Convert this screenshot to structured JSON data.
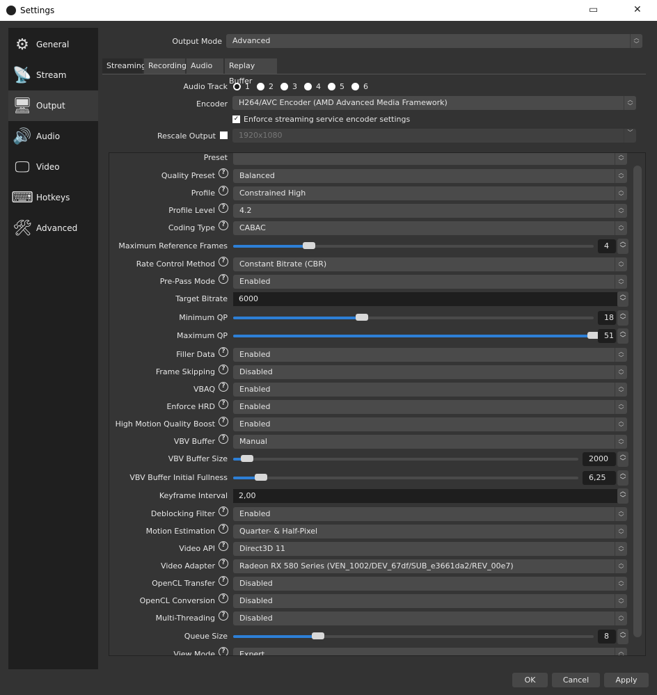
{
  "window": {
    "title": "Settings"
  },
  "sidebar": {
    "items": [
      {
        "label": "General",
        "icon": "gear-icon",
        "glyph": "⚙"
      },
      {
        "label": "Stream",
        "icon": "antenna-icon",
        "glyph": "📡"
      },
      {
        "label": "Output",
        "icon": "monitor-arrow-icon",
        "glyph": "🖥",
        "selected": true
      },
      {
        "label": "Audio",
        "icon": "speaker-icon",
        "glyph": "🔊"
      },
      {
        "label": "Video",
        "icon": "monitor-icon",
        "glyph": "🖵"
      },
      {
        "label": "Hotkeys",
        "icon": "keyboard-icon",
        "glyph": "⌨"
      },
      {
        "label": "Advanced",
        "icon": "tools-icon",
        "glyph": "🛠"
      }
    ]
  },
  "output_mode": {
    "label": "Output Mode",
    "value": "Advanced"
  },
  "tabs": [
    "Streaming",
    "Recording",
    "Audio",
    "Replay Buffer"
  ],
  "audio_track": {
    "label": "Audio Track",
    "tracks": [
      "1",
      "2",
      "3",
      "4",
      "5",
      "6"
    ],
    "selected": "1"
  },
  "encoder": {
    "label": "Encoder",
    "value": "H264/AVC Encoder (AMD Advanced Media Framework)"
  },
  "enforce": {
    "label": "Enforce streaming service encoder settings",
    "checked": true
  },
  "rescale": {
    "label": "Rescale Output",
    "checked": false,
    "value": "1920x1080"
  },
  "settings": [
    {
      "label": "Preset",
      "type": "combo",
      "value": "",
      "help": false
    },
    {
      "label": "Quality Preset",
      "type": "combo",
      "value": "Balanced",
      "help": true
    },
    {
      "label": "Profile",
      "type": "combo",
      "value": "Constrained High",
      "help": true
    },
    {
      "label": "Profile Level",
      "type": "combo",
      "value": "4.2",
      "help": true
    },
    {
      "label": "Coding Type",
      "type": "combo",
      "value": "CABAC",
      "help": true
    },
    {
      "label": "Maximum Reference Frames",
      "type": "slider",
      "value": "4",
      "fill": 0.21
    },
    {
      "label": "Rate Control Method",
      "type": "combo",
      "value": "Constant Bitrate (CBR)",
      "help": true
    },
    {
      "label": "Pre-Pass Mode",
      "type": "combo",
      "value": "Enabled",
      "help": true
    },
    {
      "label": "Target Bitrate",
      "type": "text",
      "value": "6000"
    },
    {
      "label": "Minimum QP",
      "type": "slider",
      "value": "18",
      "fill": 0.357
    },
    {
      "label": "Maximum QP",
      "type": "slider",
      "value": "51",
      "fill": 1.0
    },
    {
      "label": "Filler Data",
      "type": "combo",
      "value": "Enabled",
      "help": true
    },
    {
      "label": "Frame Skipping",
      "type": "combo",
      "value": "Disabled",
      "help": true
    },
    {
      "label": "VBAQ",
      "type": "combo",
      "value": "Enabled",
      "help": true
    },
    {
      "label": "Enforce HRD",
      "type": "combo",
      "value": "Enabled",
      "help": true
    },
    {
      "label": "High Motion Quality Boost",
      "type": "combo",
      "value": "Enabled",
      "help": true
    },
    {
      "label": "VBV Buffer",
      "type": "combo",
      "value": "Manual",
      "help": true
    },
    {
      "label": "VBV Buffer Size",
      "type": "slider",
      "value": "2000",
      "fill": 0.04,
      "wide": true
    },
    {
      "label": "VBV Buffer Initial Fullness",
      "type": "slider",
      "value": "6,25",
      "fill": 0.08,
      "wide": true
    },
    {
      "label": "Keyframe Interval",
      "type": "text",
      "value": "2,00"
    },
    {
      "label": "Deblocking Filter",
      "type": "combo",
      "value": "Enabled",
      "help": true
    },
    {
      "label": "Motion Estimation",
      "type": "combo",
      "value": "Quarter- & Half-Pixel",
      "help": true
    },
    {
      "label": "Video API",
      "type": "combo",
      "value": "Direct3D 11",
      "help": true
    },
    {
      "label": "Video Adapter",
      "type": "combo",
      "value": "Radeon RX 580 Series (VEN_1002/DEV_67df/SUB_e3661da2/REV_00e7)",
      "help": true
    },
    {
      "label": "OpenCL Transfer",
      "type": "combo",
      "value": "Disabled",
      "help": true
    },
    {
      "label": "OpenCL Conversion",
      "type": "combo",
      "value": "Disabled",
      "help": true
    },
    {
      "label": "Multi-Threading",
      "type": "combo",
      "value": "Disabled",
      "help": true
    },
    {
      "label": "Queue Size",
      "type": "slider",
      "value": "8",
      "fill": 0.235
    },
    {
      "label": "View Mode",
      "type": "combo",
      "value": "Expert",
      "help": true
    }
  ],
  "buttons": {
    "ok": "OK",
    "cancel": "Cancel",
    "apply": "Apply"
  },
  "colors": {
    "accent": "#2d7fd6"
  }
}
